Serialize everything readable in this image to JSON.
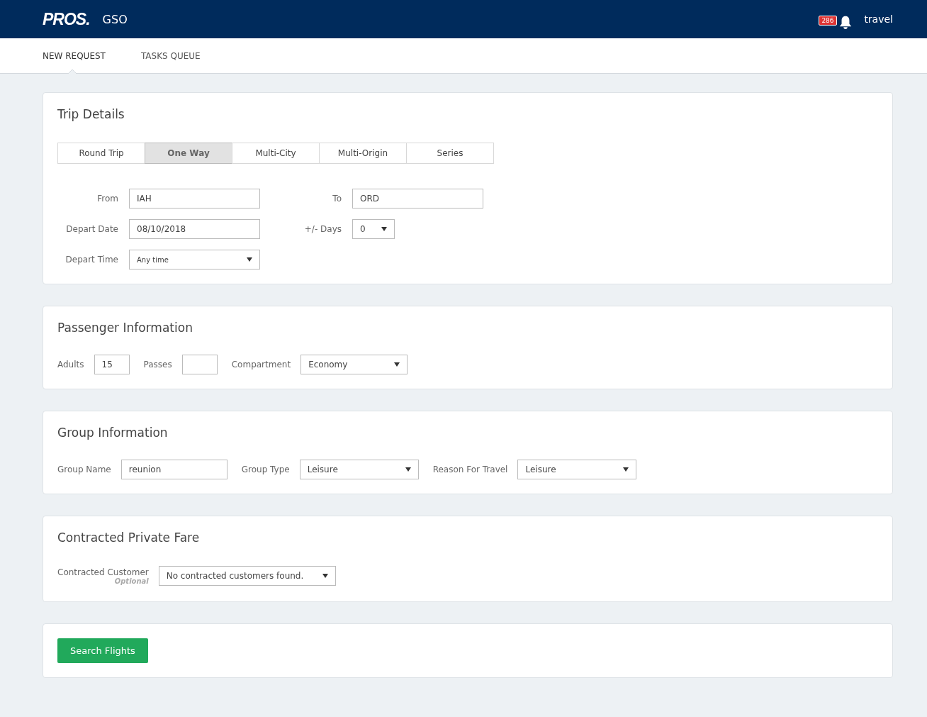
{
  "header": {
    "logo": "PROS.",
    "app": "GSO",
    "notification_count": "286",
    "user": "travel"
  },
  "nav_tabs": [
    {
      "label": "NEW REQUEST",
      "selected": true
    },
    {
      "label": "TASKS QUEUE",
      "selected": false
    }
  ],
  "trip_details": {
    "title": "Trip Details",
    "trip_types": [
      {
        "label": "Round Trip",
        "selected": false
      },
      {
        "label": "One Way",
        "selected": true
      },
      {
        "label": "Multi-City",
        "selected": false
      },
      {
        "label": "Multi-Origin",
        "selected": false
      },
      {
        "label": "Series",
        "selected": false
      }
    ],
    "fields": [
      {
        "label": "From",
        "kind": "text",
        "value": "IAH"
      },
      {
        "label": "To",
        "kind": "text",
        "value": "ORD"
      },
      {
        "label": "Depart Date",
        "kind": "text",
        "value": "08/10/2018"
      },
      {
        "label": "+/- Days",
        "kind": "select",
        "value": "0"
      },
      {
        "label": "Depart Time",
        "kind": "select",
        "value": "Any time"
      }
    ]
  },
  "passenger_information": {
    "title": "Passenger Information",
    "fields": [
      {
        "label": "Adults",
        "kind": "text",
        "value": "15"
      },
      {
        "label": "Passes",
        "kind": "text"
      },
      {
        "label": "Compartment",
        "kind": "select",
        "value": "Economy"
      }
    ]
  },
  "group_information": {
    "title": "Group Information",
    "fields": [
      {
        "label": "Group Name",
        "kind": "text",
        "value": "reunion"
      },
      {
        "label": "Group Type",
        "kind": "select",
        "value": "Leisure"
      },
      {
        "label": "Reason For Travel",
        "kind": "select",
        "value": "Leisure"
      }
    ]
  },
  "contracted_private_fare": {
    "title": "Contracted Private Fare",
    "fields": [
      {
        "label": "Contracted Customer",
        "hint": "Optional",
        "kind": "select",
        "value": "No contracted customers found."
      }
    ]
  },
  "search_button": "Search Flights"
}
